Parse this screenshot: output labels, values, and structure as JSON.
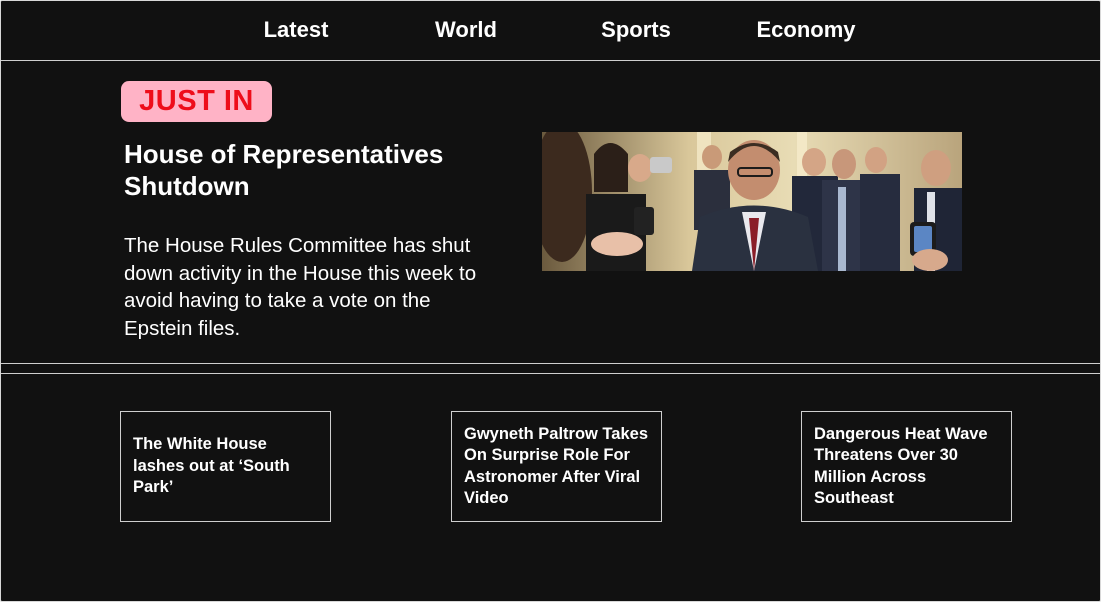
{
  "nav": {
    "items": [
      {
        "label": "Latest"
      },
      {
        "label": "World"
      },
      {
        "label": "Sports"
      },
      {
        "label": "Economy"
      }
    ]
  },
  "hero": {
    "badge": "JUST IN",
    "badge_colors": {
      "background": "#ffb3c6",
      "text": "#ee0d1a"
    },
    "headline": "House of Representatives Shutdown",
    "summary": "The House Rules Committee has shut down activity in the House this week to avoid having to take a vote on the Epstein files."
  },
  "stories": [
    {
      "title": "The White House lashes out at ‘South Park’"
    },
    {
      "title": "Gwyneth Paltrow Takes On Surprise Role For Astronomer After Viral Video"
    },
    {
      "title": "Dangerous Heat Wave Threatens Over 30 Million Across Southeast"
    }
  ],
  "theme": {
    "background": "#111111",
    "text": "#ffffff",
    "divider": "#cfcfcf"
  }
}
